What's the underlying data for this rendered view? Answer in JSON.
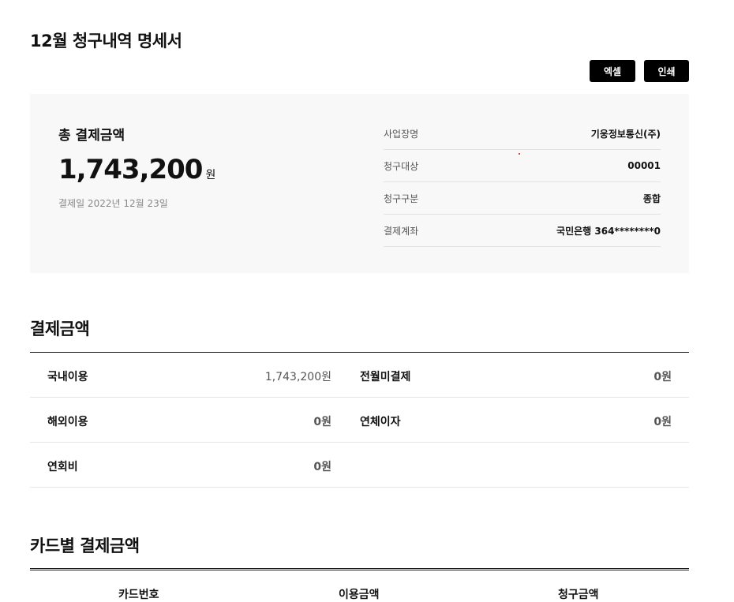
{
  "header": {
    "title": "12월 청구내역 명세서",
    "excel_label": "엑셀",
    "print_label": "인쇄"
  },
  "summary": {
    "label": "총 결제금액",
    "amount": "1,743,200",
    "unit": "원",
    "pay_date": "결제일 2022년 12월 23일",
    "info": [
      {
        "key": "사업장명",
        "value": "기웅정보통신(주)"
      },
      {
        "key": "청구대상",
        "value": "00001"
      },
      {
        "key": "청구구분",
        "value": "종합"
      },
      {
        "key": "결제계좌",
        "value": "국민은행 364********0"
      }
    ]
  },
  "payment": {
    "title": "결제금액",
    "rows": [
      {
        "label1": "국내이용",
        "value1": "1,743,200원",
        "label2": "전월미결제",
        "value2": "0원"
      },
      {
        "label1": "해외이용",
        "value1": "0원",
        "label2": "연체이자",
        "value2": "0원"
      },
      {
        "label1": "연회비",
        "value1": "0원",
        "label2": "",
        "value2": ""
      }
    ]
  },
  "card_section": {
    "title": "카드별 결제금액",
    "columns": [
      "카드번호",
      "이용금액",
      "청구금액"
    ]
  }
}
